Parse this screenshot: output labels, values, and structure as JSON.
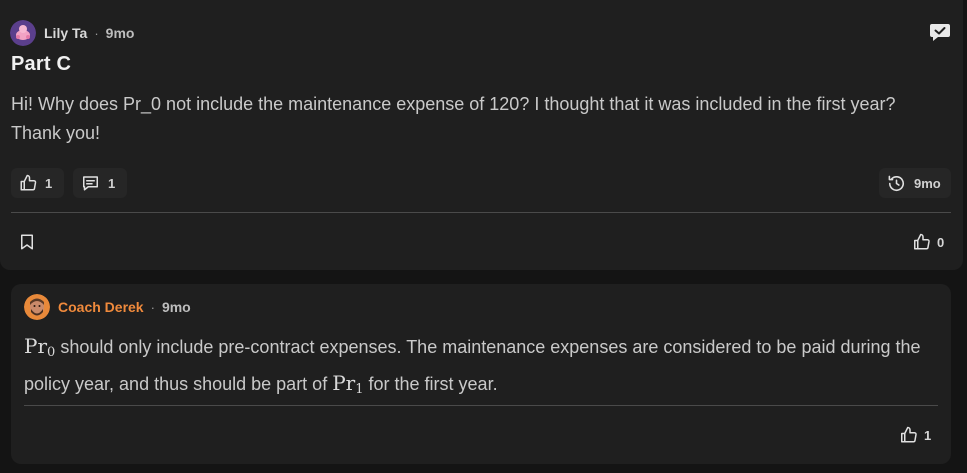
{
  "post": {
    "author": "Lily Ta",
    "separator": "·",
    "time": "9mo",
    "title": "Part C",
    "body": "Hi! Why does Pr_0 not include the maintenance expense of 120? I thought that it was included in the first year? Thank you!",
    "likes": "1",
    "comments": "1",
    "history_time": "9mo",
    "footer_likes": "0"
  },
  "reply": {
    "author": "Coach Derek",
    "separator": "·",
    "time": "9mo",
    "math_pr": "Pr",
    "sub_0": "0",
    "sub_1": "1",
    "body_part1": " should only include pre-contract expenses. The maintenance expenses are considered to be paid during the policy year, and thus should be part of ",
    "body_part2": " for the first year.",
    "likes": "1"
  },
  "colors": {
    "background": "#141414",
    "card": "#1f1f1f",
    "coach_name": "#f08a3c",
    "divider": "#4a4a4a"
  }
}
